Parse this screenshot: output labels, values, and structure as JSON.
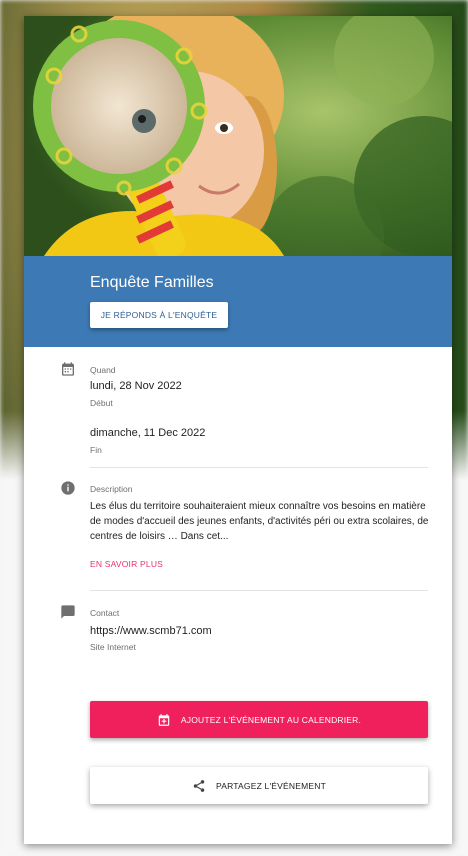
{
  "event": {
    "title": "Enquête Familles",
    "survey_button": "JE RÉPONDS À L'ENQUÊTE",
    "hero_image": "child-with-magnifying-glass-photo"
  },
  "when": {
    "label": "Quand",
    "start_value": "lundi, 28 Nov 2022",
    "start_label": "Début",
    "end_value": "dimanche, 11 Dec 2022",
    "end_label": "Fin",
    "icon": "calendar-icon"
  },
  "description": {
    "label": "Description",
    "text": "Les élus du territoire souhaiteraient mieux connaître vos besoins en matière de modes d'accueil des jeunes enfants, d'activités péri ou extra scolaires, de centres de loisirs … Dans cet...",
    "more_link": "EN SAVOIR PLUS",
    "icon": "info-icon"
  },
  "contact": {
    "label": "Contact",
    "value": "https://www.scmb71.com",
    "sublabel": "Site Internet",
    "icon": "chat-icon"
  },
  "actions": {
    "calendar_button": "AJOUTEZ L'ÉVÉNEMENT AU CALENDRIER.",
    "share_button": "PARTAGEZ L'ÉVÉNEMENT"
  },
  "colors": {
    "banner": "#3d7ab5",
    "accent": "#f0205c",
    "link": "#e8336f"
  }
}
